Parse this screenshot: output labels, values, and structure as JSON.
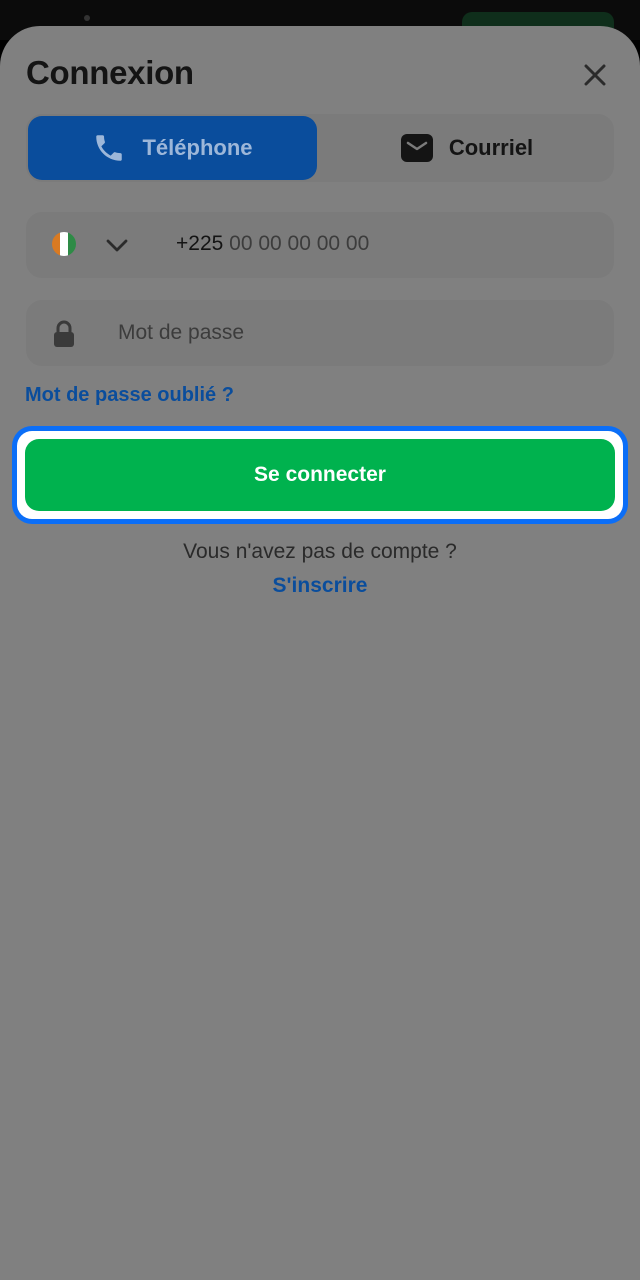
{
  "header": {
    "title": "Connexion",
    "close_icon": "close-icon"
  },
  "tabs": [
    {
      "label": "Téléphone",
      "icon": "phone-icon",
      "selected": true
    },
    {
      "label": "Courriel",
      "icon": "envelope-icon",
      "selected": false
    }
  ],
  "phone_field": {
    "country_flag": "ivory-coast-flag-icon",
    "flag_colors": [
      "#d97a22",
      "#ffffff",
      "#2e8b46"
    ],
    "dial_code": "+225",
    "placeholder": "00 00 00 00 00"
  },
  "password_field": {
    "placeholder": "Mot de passe",
    "value": ""
  },
  "links": {
    "forgot_password": "Mot de passe oublié ?",
    "signup": "S'inscrire"
  },
  "login_button": {
    "label": "Se connecter"
  },
  "signup_prompt": "Vous n'avez pas de compte ?",
  "colors": {
    "accent_blue": "#0a4d9c",
    "focus_ring": "#0b6ef7",
    "login_green": "#00b24e",
    "overlay_gray": "#808080"
  }
}
